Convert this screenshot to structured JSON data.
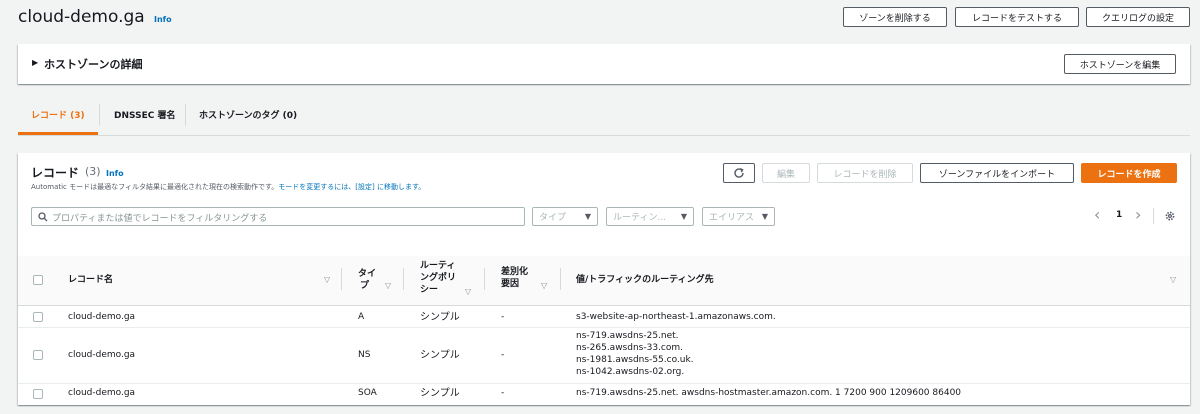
{
  "page": {
    "title": "cloud-demo.ga",
    "info": "Info"
  },
  "header_buttons": {
    "delete_zone": "ゾーンを削除する",
    "test_record": "レコードをテストする",
    "query_log": "クエリログの設定"
  },
  "details": {
    "expand_icon": "▶",
    "title": "ホストゾーンの詳細",
    "edit_button": "ホストゾーンを編集"
  },
  "tabs": [
    {
      "label": "レコード (3)",
      "active": true
    },
    {
      "label": "DNSSEC 署名",
      "active": false
    },
    {
      "label": "ホストゾーンのタグ (0)",
      "active": false
    }
  ],
  "records": {
    "title": "レコード",
    "count": "(3)",
    "info": "Info",
    "desc": "Automatic モードは最適なフィルタ結果に最適化された現在の検索動作です。",
    "desc_link": "モードを変更するには、[設定] に移動します。",
    "refresh_icon": "refresh-icon",
    "edit_button": "編集",
    "delete_button": "レコードを削除",
    "import_button": "ゾーンファイルをインポート",
    "create_button": "レコードを作成",
    "search_placeholder": "プロパティまたは値でレコードをフィルタリングする",
    "filter_type": "タイプ",
    "filter_routing": "ルーティン...",
    "filter_alias": "エイリアス",
    "page_number": "1",
    "prev_icon": "‹",
    "next_icon": "›",
    "settings_icon": "gear-icon",
    "columns": {
      "name": "レコード名",
      "type_1": "タイ",
      "type_2": "プ",
      "routing_1": "ルーティ",
      "routing_2": "ングポリ",
      "routing_3": "シー",
      "diff_1": "差別化",
      "diff_2": "要因",
      "value": "値/トラフィックのルーティング先"
    },
    "rows": [
      {
        "name": "cloud-demo.ga",
        "type": "A",
        "routing": "シンプル",
        "diff": "-",
        "values": [
          "s3-website-ap-northeast-1.amazonaws.com."
        ]
      },
      {
        "name": "cloud-demo.ga",
        "type": "NS",
        "routing": "シンプル",
        "diff": "-",
        "values": [
          "ns-719.awsdns-25.net.",
          "ns-265.awsdns-33.com.",
          "ns-1981.awsdns-55.co.uk.",
          "ns-1042.awsdns-02.org."
        ]
      },
      {
        "name": "cloud-demo.ga",
        "type": "SOA",
        "routing": "シンプル",
        "diff": "-",
        "values": [
          "ns-719.awsdns-25.net. awsdns-hostmaster.amazon.com. 1 7200 900 1209600 86400"
        ]
      }
    ]
  },
  "colors": {
    "accent": "#ec7211",
    "link": "#0073bb"
  }
}
